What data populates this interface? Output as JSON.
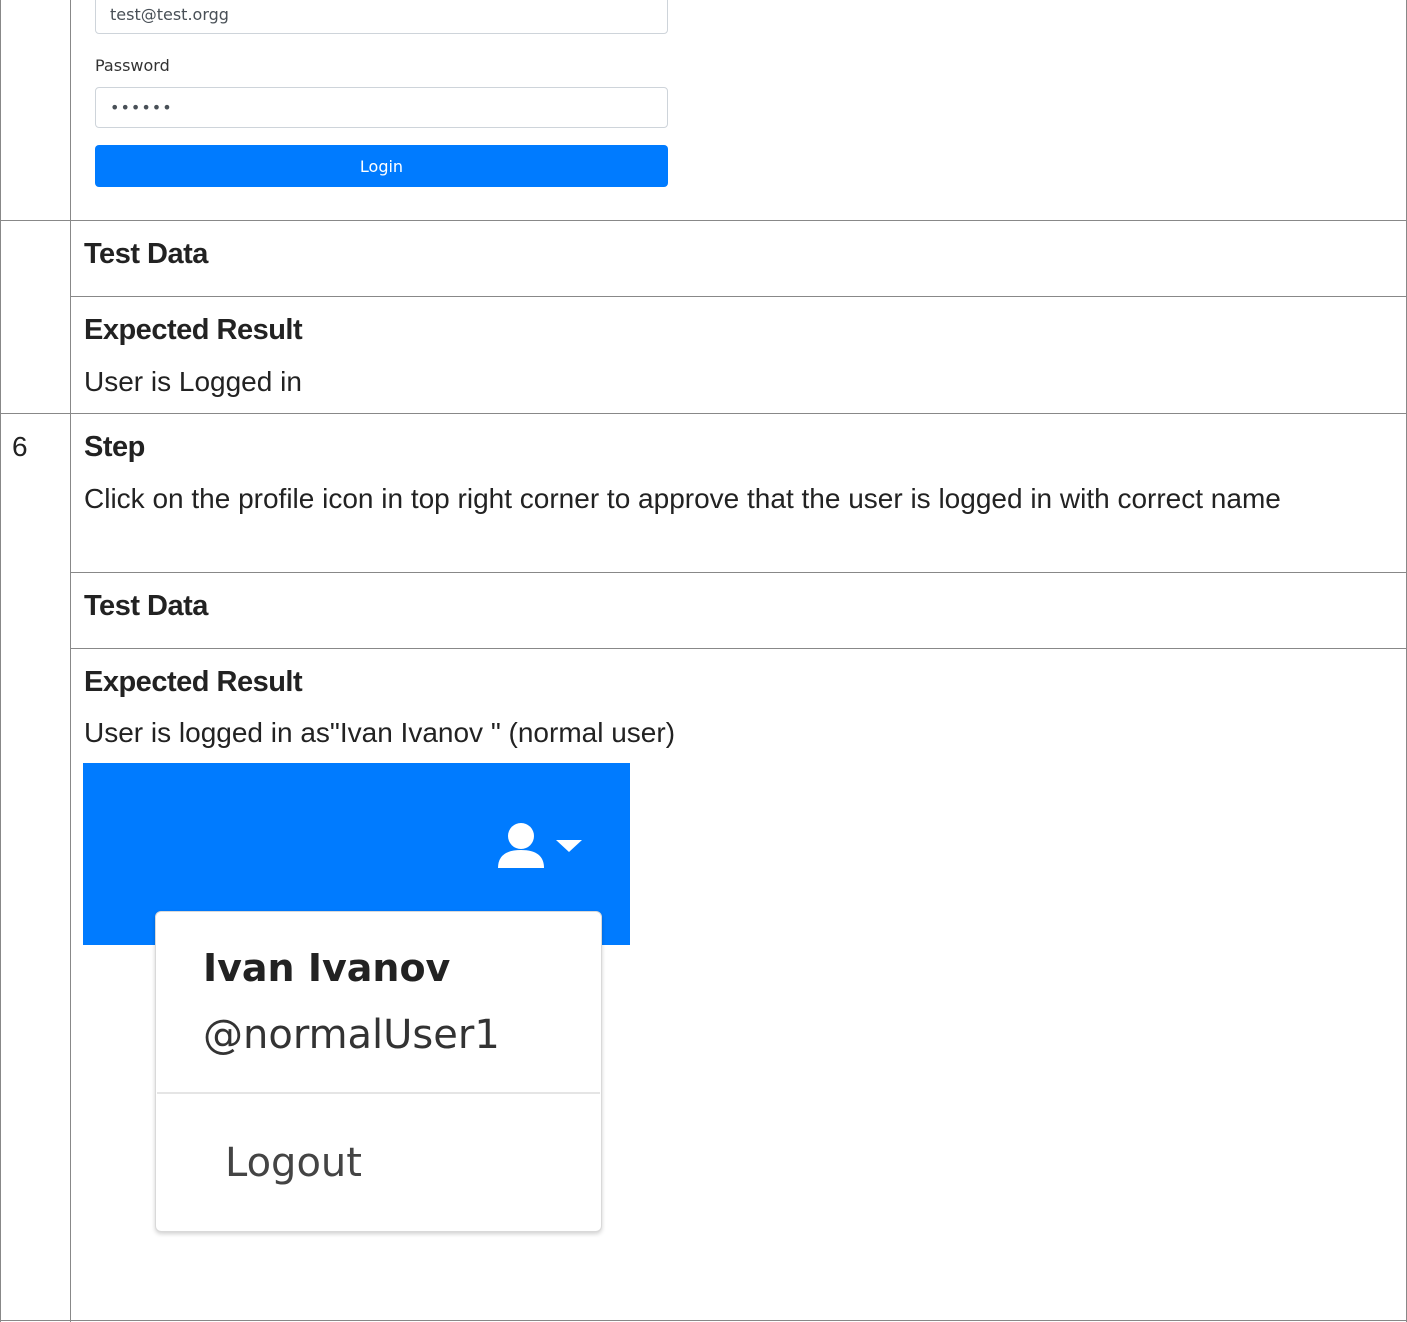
{
  "login_form": {
    "email_value": "test@test.orgg",
    "password_label": "Password",
    "password_value": "••••••",
    "login_button_label": "Login"
  },
  "rows": {
    "prev_test_data_heading": "Test Data",
    "prev_expected_heading": "Expected Result",
    "prev_expected_text": "User is Logged in",
    "step_number": "6",
    "step_heading": "Step",
    "step_text": "Click on the profile icon in top right corner to approve that the user is logged in with correct name",
    "test_data_heading": "Test Data",
    "expected_heading": "Expected Result",
    "expected_text": "User is logged in as\"Ivan Ivanov \" (normal user)"
  },
  "profile_screenshot": {
    "user_icon": "user-icon",
    "caret_icon": "caret-down-icon",
    "user_name": "Ivan Ivanov",
    "user_handle": "@normalUser1",
    "logout_label": "Logout",
    "brand_color": "#007bff"
  }
}
